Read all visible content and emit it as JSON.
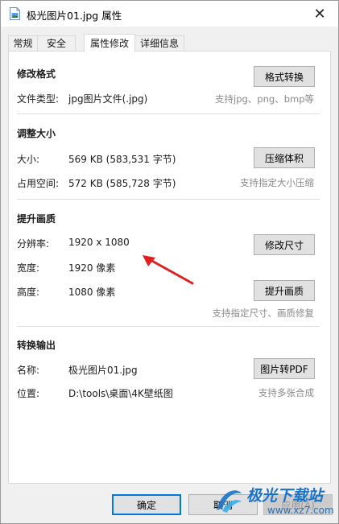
{
  "window": {
    "title": "极光图片01.jpg 属性",
    "close_glyph": "✕"
  },
  "tabs": [
    {
      "label": "常规",
      "active": false
    },
    {
      "label": "安全",
      "active": false
    },
    {
      "label": "属性修改",
      "active": true
    },
    {
      "label": "详细信息",
      "active": false
    }
  ],
  "format_section": {
    "title": "修改格式",
    "file_type_label": "文件类型:",
    "file_type_value": "jpg图片文件(.jpg)",
    "button": "格式转换",
    "hint": "支持jpg、png、bmp等"
  },
  "size_section": {
    "title": "调整大小",
    "size_label": "大小:",
    "size_value": "569 KB (583,531 字节)",
    "disk_label": "占用空间:",
    "disk_value": "572 KB (585,728 字节)",
    "button": "压缩体积",
    "hint": "支持指定大小压缩"
  },
  "quality_section": {
    "title": "提升画质",
    "resolution_label": "分辨率:",
    "resolution_value": "1920 x 1080",
    "width_label": "宽度:",
    "width_value": "1920 像素",
    "height_label": "高度:",
    "height_value": "1080 像素",
    "resize_button": "修改尺寸",
    "enhance_button": "提升画质",
    "hint": "支持指定尺寸、画质修复"
  },
  "output_section": {
    "title": "转换输出",
    "name_label": "名称:",
    "name_value": "极光图片01.jpg",
    "location_label": "位置:",
    "location_value": "D:\\tools\\桌面\\4K壁纸图",
    "button": "图片转PDF",
    "hint": "支持多张合成"
  },
  "footer": {
    "ok": "确定",
    "cancel": "取消",
    "apply": "应用(A)"
  },
  "watermark": {
    "brand": "极光下载站",
    "url": "www.xz7.com"
  },
  "colors": {
    "accent": "#0078d7",
    "arrow": "#e02020",
    "hint": "#8a8a8a"
  }
}
